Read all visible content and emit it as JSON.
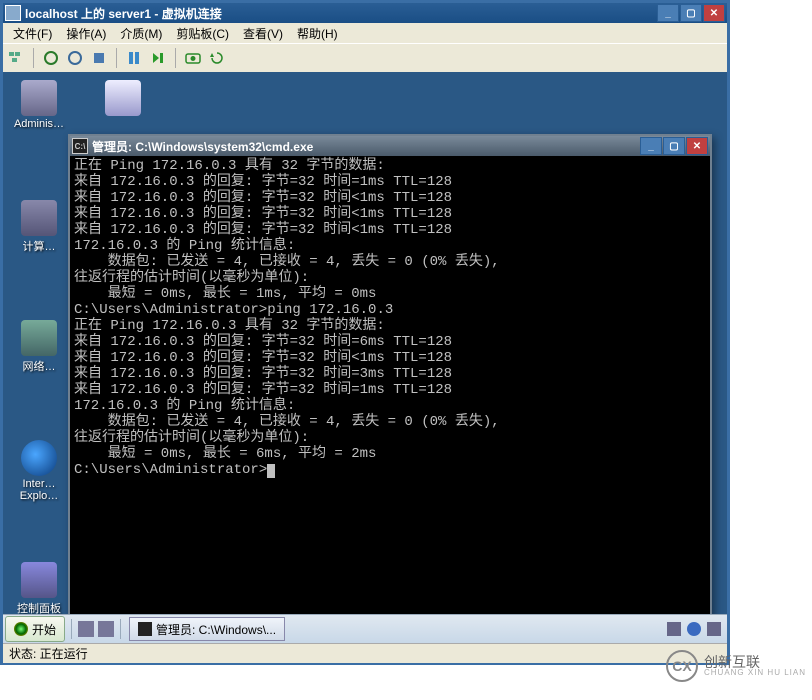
{
  "vm": {
    "title": "localhost 上的 server1 - 虚拟机连接",
    "menu": [
      "文件(F)",
      "操作(A)",
      "介质(M)",
      "剪贴板(C)",
      "查看(V)",
      "帮助(H)"
    ],
    "status": "状态: 正在运行"
  },
  "desktop_icons": {
    "admin": "Adminis…",
    "recycle": "",
    "computer": "计算…",
    "network": "网络…",
    "ie_line1": "Inter…",
    "ie_line2": "Explo…",
    "control_panel": "控制面板"
  },
  "taskbar": {
    "start": "开始",
    "task": "管理员: C:\\Windows\\..."
  },
  "cmd": {
    "title": "管理员: C:\\Windows\\system32\\cmd.exe",
    "lines": [
      "正在 Ping 172.16.0.3 具有 32 字节的数据:",
      "来自 172.16.0.3 的回复: 字节=32 时间=1ms TTL=128",
      "来自 172.16.0.3 的回复: 字节=32 时间<1ms TTL=128",
      "来自 172.16.0.3 的回复: 字节=32 时间<1ms TTL=128",
      "来自 172.16.0.3 的回复: 字节=32 时间<1ms TTL=128",
      "",
      "172.16.0.3 的 Ping 统计信息:",
      "    数据包: 已发送 = 4, 已接收 = 4, 丢失 = 0 (0% 丢失),",
      "往返行程的估计时间(以毫秒为单位):",
      "    最短 = 0ms, 最长 = 1ms, 平均 = 0ms",
      "",
      "C:\\Users\\Administrator>ping 172.16.0.3",
      "",
      "正在 Ping 172.16.0.3 具有 32 字节的数据:",
      "来自 172.16.0.3 的回复: 字节=32 时间=6ms TTL=128",
      "来自 172.16.0.3 的回复: 字节=32 时间<1ms TTL=128",
      "来自 172.16.0.3 的回复: 字节=32 时间=3ms TTL=128",
      "来自 172.16.0.3 的回复: 字节=32 时间=1ms TTL=128",
      "",
      "172.16.0.3 的 Ping 统计信息:",
      "    数据包: 已发送 = 4, 已接收 = 4, 丢失 = 0 (0% 丢失),",
      "往返行程的估计时间(以毫秒为单位):",
      "    最短 = 0ms, 最长 = 6ms, 平均 = 2ms",
      "",
      "C:\\Users\\Administrator>"
    ]
  },
  "watermark": {
    "logo": "CX",
    "text": "创新互联"
  }
}
